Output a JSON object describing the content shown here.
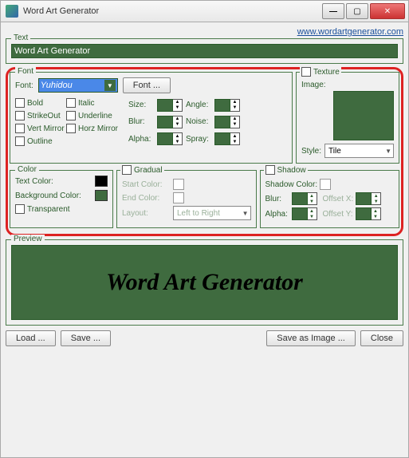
{
  "window": {
    "title": "Word Art Generator"
  },
  "link": "www.wordartgenerator.com",
  "text": {
    "legend": "Text",
    "value": "Word Art Generator"
  },
  "font": {
    "legend": "Font",
    "label": "Font:",
    "selected": "Yuhidou",
    "button": "Font ...",
    "checks": {
      "bold": "Bold",
      "italic": "Italic",
      "strikeout": "StrikeOut",
      "underline": "Underline",
      "vertmirror": "Vert Mirror",
      "horzmirror": "Horz Mirror",
      "outline": "Outline"
    },
    "nums": {
      "size": "Size:",
      "angle": "Angle:",
      "blur": "Blur:",
      "noise": "Noise:",
      "alpha": "Alpha:",
      "spray": "Spray:"
    }
  },
  "texture": {
    "legend": "Texture",
    "image": "Image:",
    "style": "Style:",
    "style_value": "Tile"
  },
  "color": {
    "legend": "Color",
    "textcolor": "Text Color:",
    "bgcolor": "Background Color:",
    "transparent": "Transparent"
  },
  "gradual": {
    "legend": "Gradual",
    "start": "Start Color:",
    "end": "End Color:",
    "layout": "Layout:",
    "layout_value": "Left to Right"
  },
  "shadow": {
    "legend": "Shadow",
    "color": "Shadow Color:",
    "blur": "Blur:",
    "offsetx": "Offset X:",
    "alpha": "Alpha:",
    "offsety": "Offset Y:"
  },
  "preview": {
    "legend": "Preview",
    "text": "Word Art Generator"
  },
  "buttons": {
    "load": "Load ...",
    "save": "Save ...",
    "saveimg": "Save as Image ...",
    "close": "Close"
  }
}
